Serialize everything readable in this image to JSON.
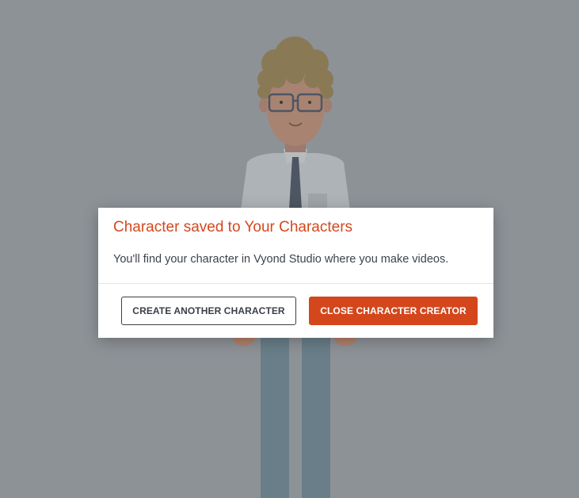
{
  "colors": {
    "overlay_background": "#8d9297",
    "accent": "#d4481d",
    "primary_button": "#d4461c",
    "body_text": "#3d434a"
  },
  "background": {
    "description": "character-preview"
  },
  "dialog": {
    "title": "Character saved to Your Characters",
    "message": "You'll find your character in Vyond Studio where you make videos.",
    "buttons": {
      "secondary_label": "CREATE ANOTHER CHARACTER",
      "primary_label": "CLOSE CHARACTER CREATOR"
    }
  }
}
